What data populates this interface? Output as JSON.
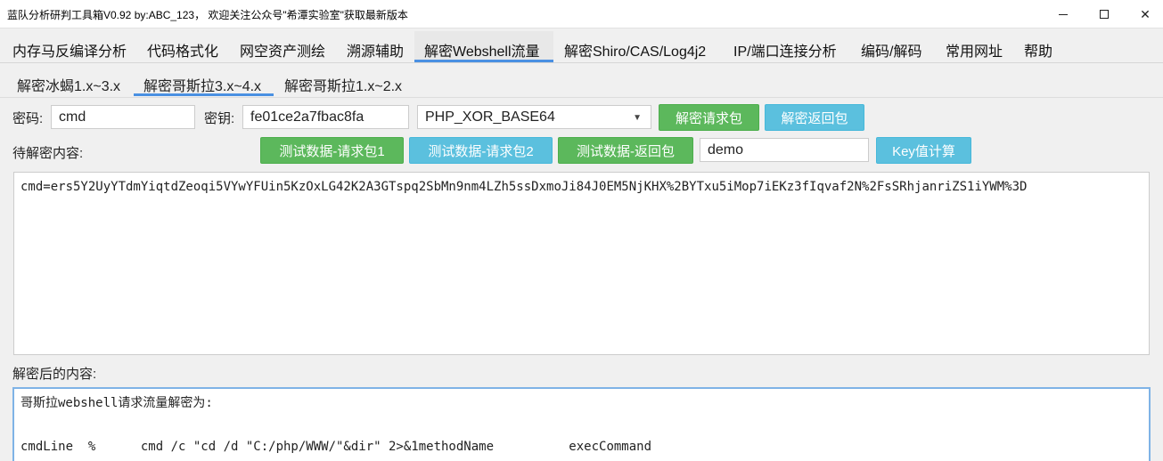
{
  "window": {
    "title": "蓝队分析研判工具箱V0.92 by:ABC_123， 欢迎关注公众号\"希潭实验室\"获取最新版本"
  },
  "menu": {
    "items": [
      "内存马反编译分析",
      "代码格式化",
      "网空资产测绘",
      "溯源辅助",
      "解密Webshell流量",
      "解密Shiro/CAS/Log4j2",
      "IP/端口连接分析",
      "编码/解码",
      "常用网址",
      "帮助"
    ],
    "active": "解密Webshell流量"
  },
  "subtabs": {
    "items": [
      "解密冰蝎1.x~3.x",
      "解密哥斯拉3.x~4.x",
      "解密哥斯拉1.x~2.x"
    ],
    "active": "解密哥斯拉3.x~4.x"
  },
  "form": {
    "password_label": "密码:",
    "password_value": "cmd",
    "key_label": "密钥:",
    "key_value": "fe01ce2a7fbac8fa",
    "mode_value": "PHP_XOR_BASE64",
    "decrypt_request_btn": "解密请求包",
    "decrypt_response_btn": "解密返回包",
    "pending_label": "待解密内容:",
    "test_req1_btn": "测试数据-请求包1",
    "test_req2_btn": "测试数据-请求包2",
    "test_resp_btn": "测试数据-返回包",
    "key_calc_input": "demo",
    "key_calc_btn": "Key值计算",
    "result_label": "解密后的内容:"
  },
  "input_text": "cmd=ers5Y2UyYTdmYiqtdZeoqi5VYwYFUin5KzOxLG42K2A3GTspq2SbMn9nm4LZh5ssDxmoJi84J0EM5NjKHX%2BYTxu5iMop7iEKz3fIqvaf2N%2FsSRhjanriZS1iYWM%3D",
  "output_lines": [
    "哥斯拉webshell请求流量解密为:",
    "",
    "cmdLine  %      cmd /c \"cd /d \"C:/php/WWW/\"&dir\" 2>&1methodName          execCommand"
  ]
}
